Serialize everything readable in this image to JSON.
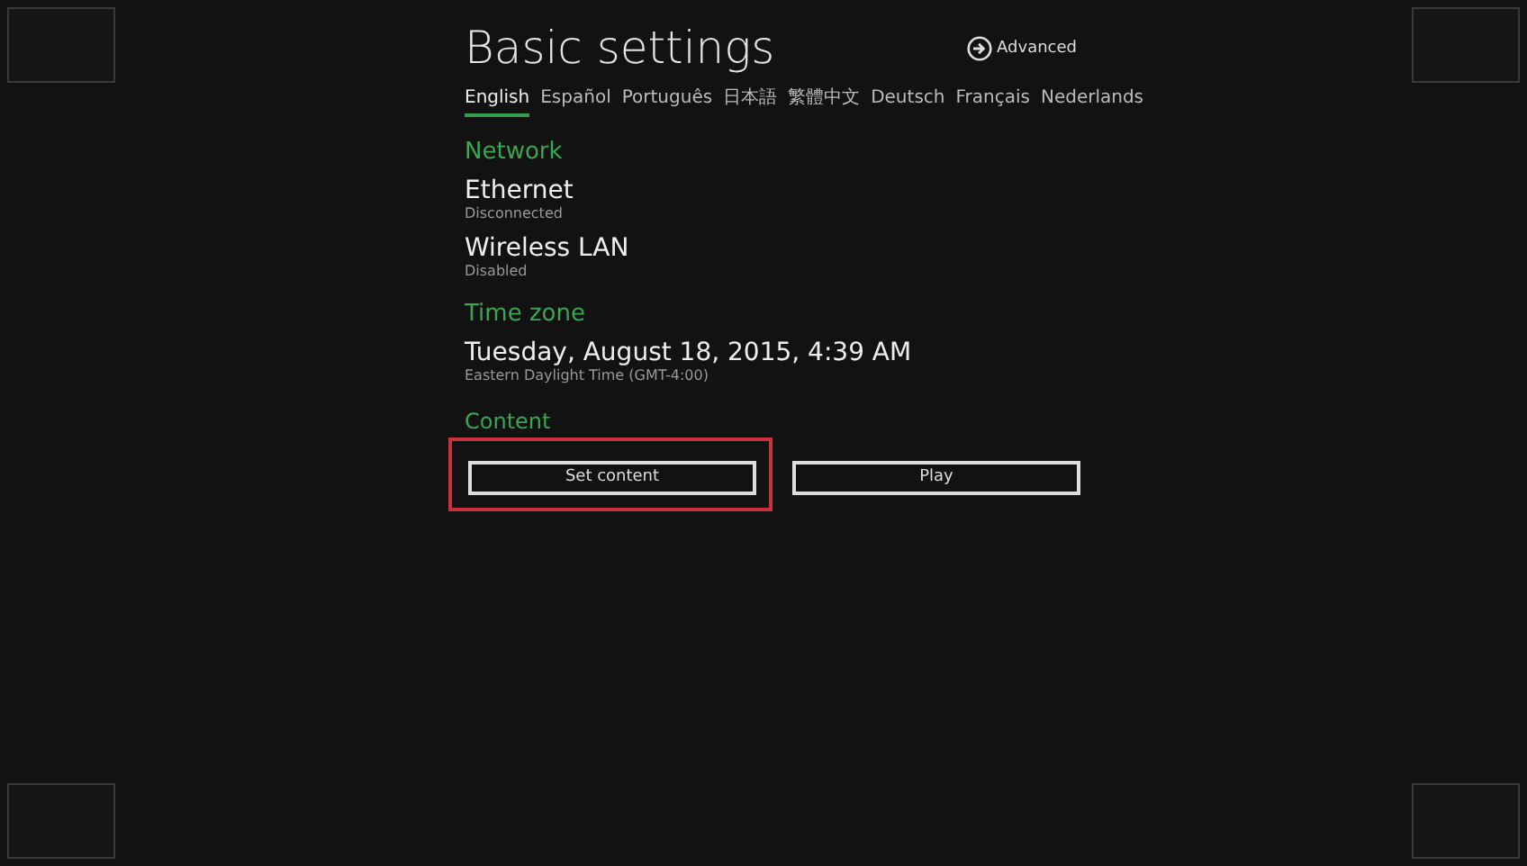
{
  "title": "Basic settings",
  "advanced": {
    "label": "Advanced"
  },
  "languages": [
    {
      "label": "English",
      "selected": true
    },
    {
      "label": "Español",
      "selected": false
    },
    {
      "label": "Português",
      "selected": false
    },
    {
      "label": "日本語",
      "selected": false
    },
    {
      "label": "繁體中文",
      "selected": false
    },
    {
      "label": "Deutsch",
      "selected": false
    },
    {
      "label": "Français",
      "selected": false
    },
    {
      "label": "Nederlands",
      "selected": false
    }
  ],
  "sections": [
    {
      "heading": "Network",
      "items": [
        {
          "title": "Ethernet",
          "subtitle": "Disconnected"
        },
        {
          "title": "Wireless LAN",
          "subtitle": "Disabled"
        }
      ]
    },
    {
      "heading": "Time zone",
      "items": [
        {
          "title": "Tuesday, August 18, 2015, 4:39 AM",
          "subtitle": "Eastern Daylight Time (GMT-4:00)"
        }
      ]
    }
  ],
  "content": {
    "heading": "Content",
    "buttons": [
      {
        "label": "Set content",
        "highlighted": true
      },
      {
        "label": "Play",
        "highlighted": false
      }
    ]
  }
}
